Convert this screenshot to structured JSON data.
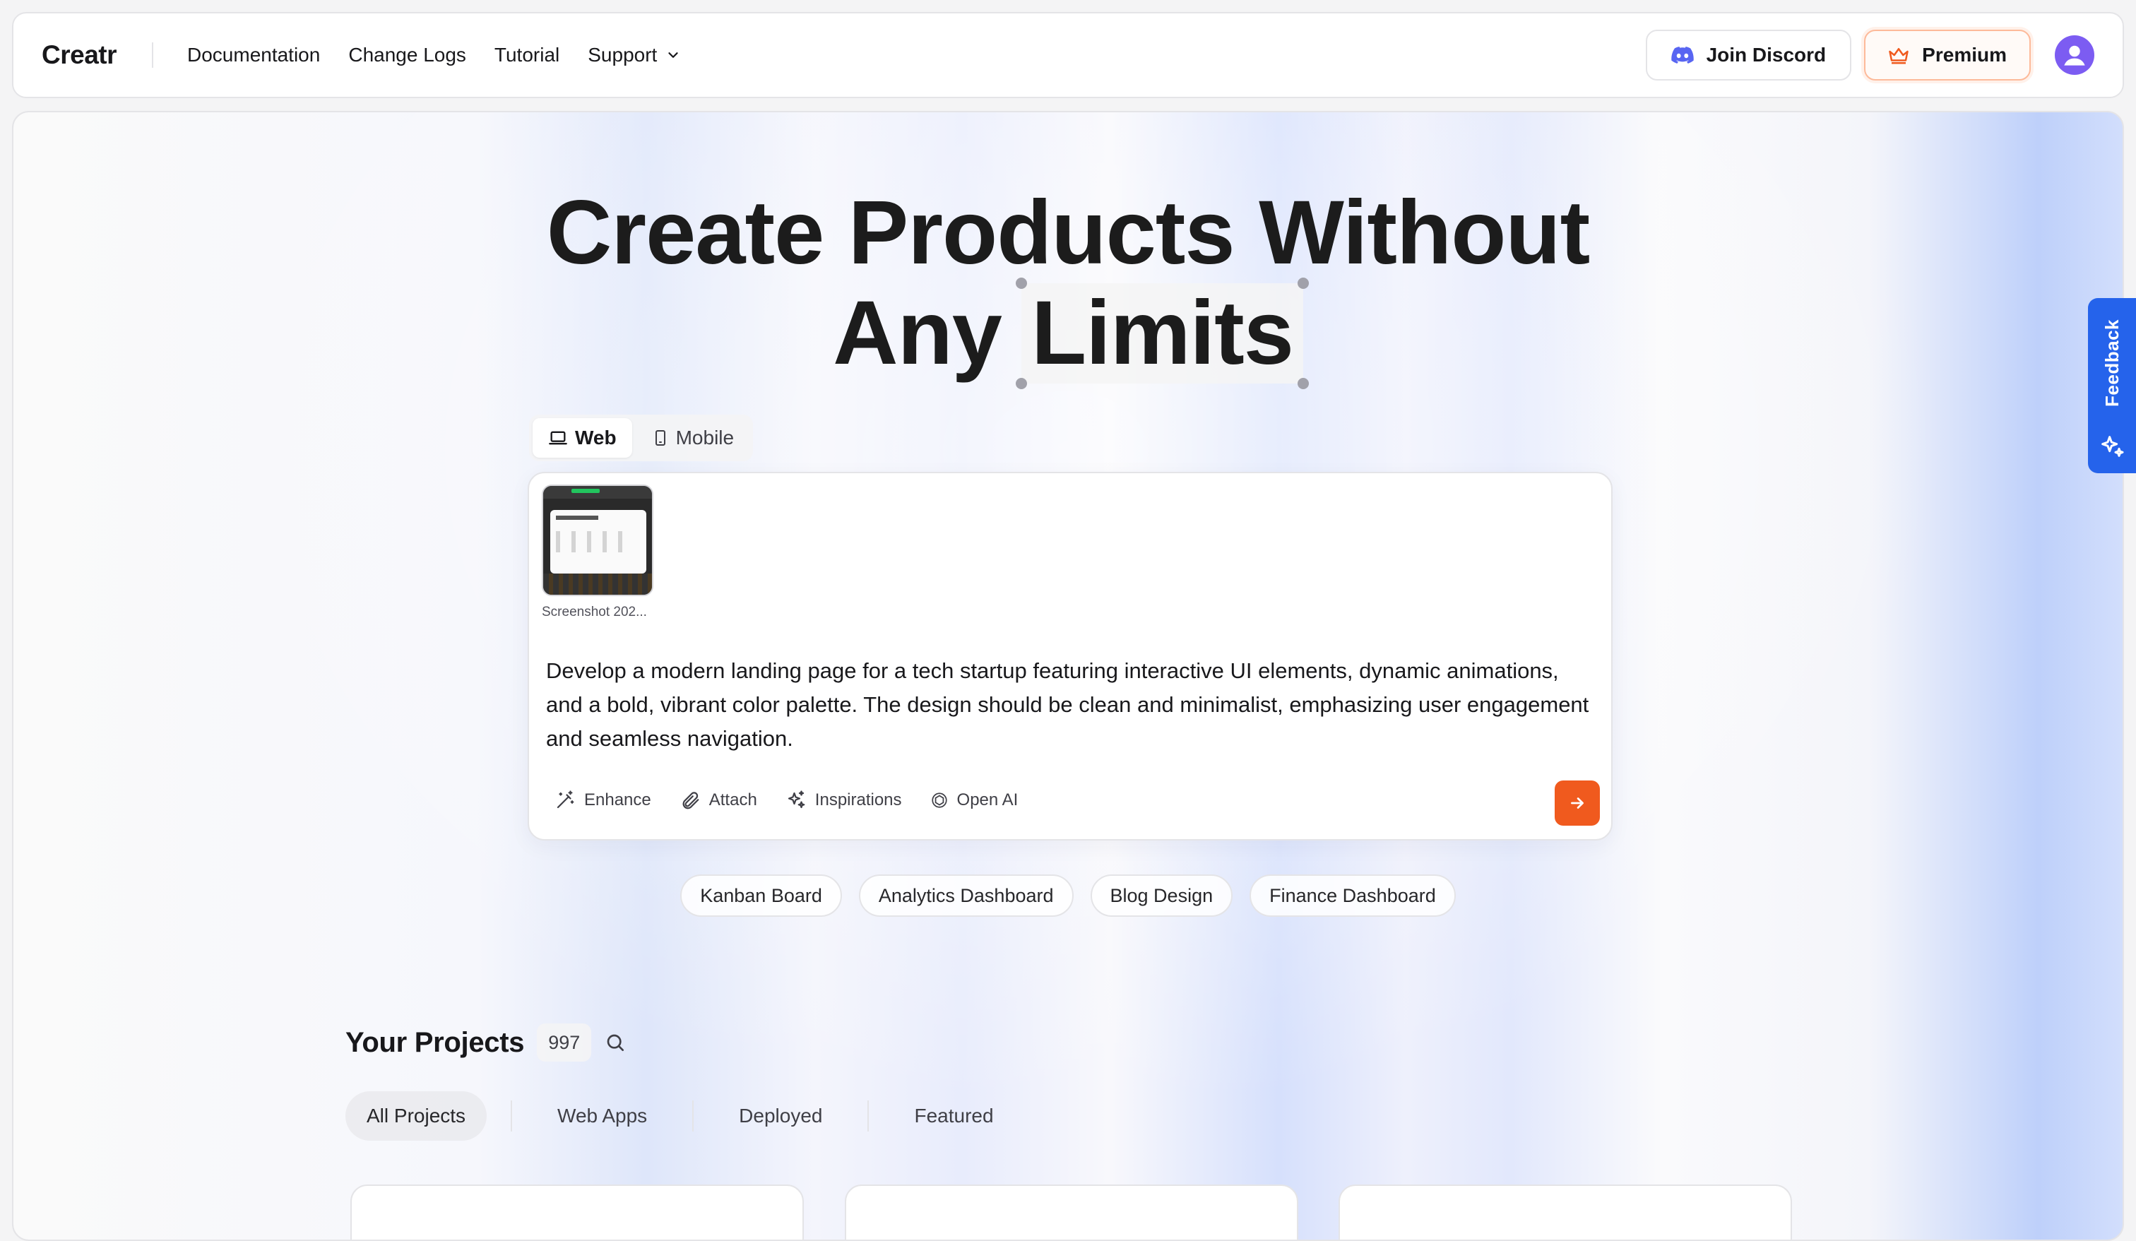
{
  "header": {
    "brand": "Creatr",
    "nav": [
      "Documentation",
      "Change Logs",
      "Tutorial"
    ],
    "support_label": "Support",
    "discord_label": "Join Discord",
    "premium_label": "Premium"
  },
  "hero": {
    "line1": "Create Products Without",
    "line2_word1": "Any",
    "line2_word2": "Limits"
  },
  "mode": {
    "web": "Web",
    "mobile": "Mobile"
  },
  "composer": {
    "attachment_name": "Screenshot 202...",
    "prompt": "Develop a modern landing page for a tech startup featuring interactive UI elements, dynamic animations, and a bold, vibrant color palette. The design should be clean and minimalist, emphasizing user engagement and seamless navigation.",
    "tools": {
      "enhance": "Enhance",
      "attach": "Attach",
      "inspirations": "Inspirations",
      "model": "Open AI"
    }
  },
  "suggestions": [
    "Kanban Board",
    "Analytics Dashboard",
    "Blog Design",
    "Finance Dashboard"
  ],
  "projects": {
    "title": "Your Projects",
    "count": "997",
    "filters": [
      "All Projects",
      "Web Apps",
      "Deployed",
      "Featured"
    ]
  },
  "feedback_label": "Feedback",
  "colors": {
    "accent": "#f05a1e",
    "feedback": "#2563eb",
    "avatar": "#7c5cf2",
    "discord": "#5865f2"
  }
}
